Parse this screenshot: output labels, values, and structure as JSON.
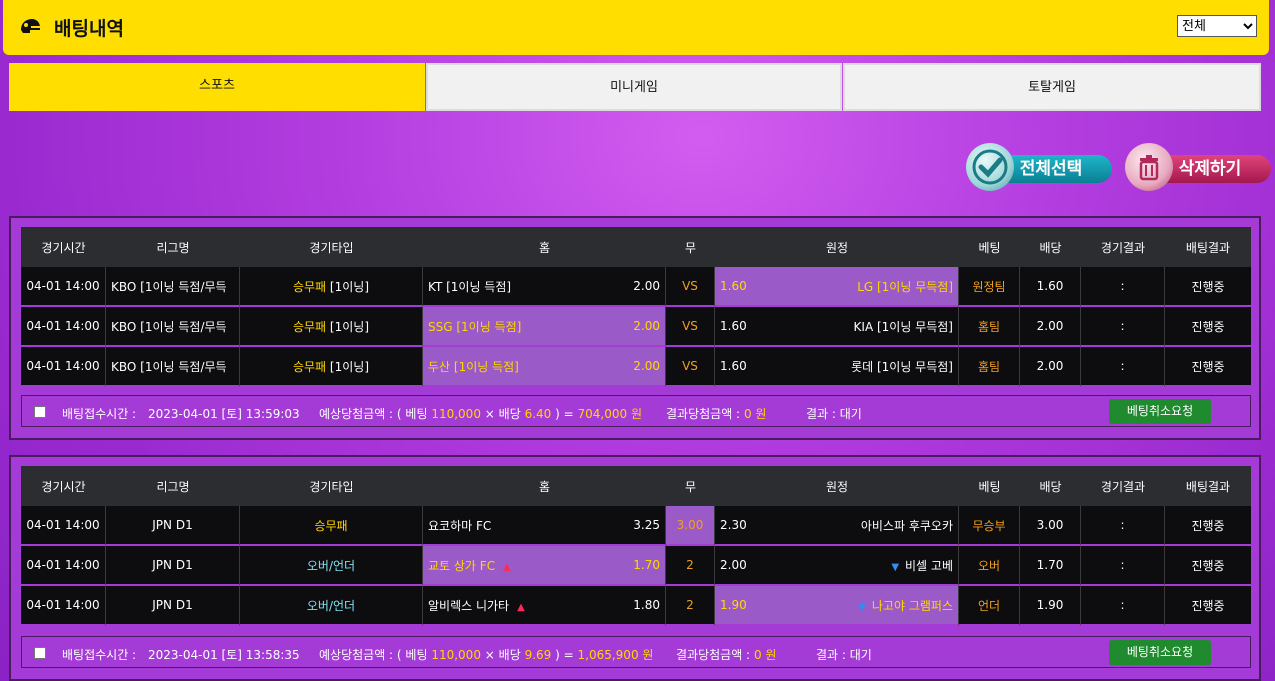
{
  "header": {
    "title": "배팅내역",
    "filter_value": "전체"
  },
  "tabs": [
    {
      "label": "스포츠"
    },
    {
      "label": "미니게임"
    },
    {
      "label": "토탈게임"
    }
  ],
  "actions": {
    "select_all": "전체선택",
    "delete": "삭제하기"
  },
  "columns": [
    "경기시간",
    "리그명",
    "경기타입",
    "홈",
    "무",
    "원정",
    "베팅",
    "배당",
    "경기결과",
    "배팅결과"
  ],
  "bets": [
    {
      "rows": [
        {
          "time": "04-01 14:00",
          "league": "KBO [1이닝 득점/무득",
          "type_a": "승무패",
          "type_b": "[1이닝]",
          "home": "KT [1이닝 득점]",
          "home_odds": "2.00",
          "draw": "VS",
          "away_odds": "1.60",
          "away": "LG [1이닝 무득점]",
          "pick": "원정팀",
          "odds": "1.60",
          "result": ":",
          "status": "진행중"
        },
        {
          "time": "04-01 14:00",
          "league": "KBO [1이닝 득점/무득",
          "type_a": "승무패",
          "type_b": "[1이닝]",
          "home": "SSG [1이닝 득점]",
          "home_odds": "2.00",
          "draw": "VS",
          "away_odds": "1.60",
          "away": "KIA [1이닝 무득점]",
          "pick": "홈팀",
          "odds": "2.00",
          "result": ":",
          "status": "진행중"
        },
        {
          "time": "04-01 14:00",
          "league": "KBO [1이닝 득점/무득",
          "type_a": "승무패",
          "type_b": "[1이닝]",
          "home": "두산 [1이닝 득점]",
          "home_odds": "2.00",
          "draw": "VS",
          "away_odds": "1.60",
          "away": "롯데 [1이닝 무득점]",
          "pick": "홈팀",
          "odds": "2.00",
          "result": ":",
          "status": "진행중"
        }
      ],
      "footer": {
        "time_label": "배팅접수시간 :",
        "time_value": "2023-04-01 [토] 13:59:03",
        "expected_label": "예상당첨금액 : ( 베팅",
        "bet_amount": "110,000",
        "times": "× 배당",
        "total_odds": "6.40",
        "eq": ") =",
        "expected_amount": "704,000 원",
        "result_amount_label": "결과당첨금액 :",
        "result_amount": "0 원",
        "result_label": "결과 : 대기",
        "cancel": "베팅취소요청"
      }
    },
    {
      "rows": [
        {
          "time": "04-01 14:00",
          "league": "JPN D1",
          "type_a": "승무패",
          "type_b": "",
          "home": "요코하마 FC",
          "home_odds": "3.25",
          "draw": "3.00",
          "away_odds": "2.30",
          "away": "아비스파 후쿠오카",
          "pick": "무승부",
          "odds": "3.00",
          "result": ":",
          "status": "진행중"
        },
        {
          "time": "04-01 14:00",
          "league": "JPN D1",
          "type_a": "오버/언더",
          "type_b": "",
          "home": "교토 상가 FC",
          "home_odds": "1.70",
          "draw": "2",
          "away_odds": "2.00",
          "away": "비셀 고베",
          "pick": "오버",
          "odds": "1.70",
          "result": ":",
          "status": "진행중"
        },
        {
          "time": "04-01 14:00",
          "league": "JPN D1",
          "type_a": "오버/언더",
          "type_b": "",
          "home": "알비렉스 니가타",
          "home_odds": "1.80",
          "draw": "2",
          "away_odds": "1.90",
          "away": "나고야 그램퍼스",
          "pick": "언더",
          "odds": "1.90",
          "result": ":",
          "status": "진행중"
        }
      ],
      "footer": {
        "time_label": "배팅접수시간 :",
        "time_value": "2023-04-01 [토] 13:58:35",
        "expected_label": "예상당첨금액 : ( 베팅",
        "bet_amount": "110,000",
        "times": "× 배당",
        "total_odds": "9.69",
        "eq": ") =",
        "expected_amount": "1,065,900 원",
        "result_amount_label": "결과당첨금액 :",
        "result_amount": "0 원",
        "result_label": "결과 : 대기",
        "cancel": "베팅취소요청"
      }
    }
  ]
}
